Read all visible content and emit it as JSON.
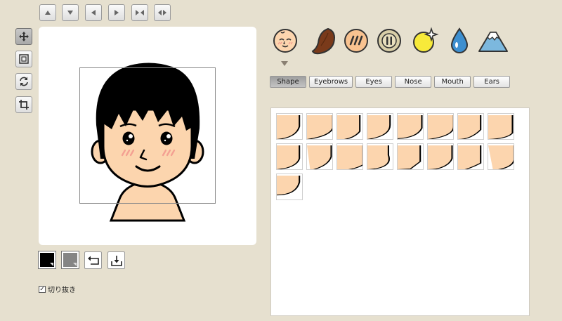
{
  "toolbar_top": {
    "buttons": [
      {
        "name": "move-up-button",
        "icon": "arrow-up-icon"
      },
      {
        "name": "move-down-button",
        "icon": "arrow-down-icon"
      },
      {
        "name": "move-left-button",
        "icon": "arrow-left-icon"
      },
      {
        "name": "move-right-button",
        "icon": "arrow-right-icon"
      },
      {
        "name": "narrow-button",
        "icon": "narrow-icon"
      },
      {
        "name": "widen-button",
        "icon": "widen-icon"
      }
    ]
  },
  "tools_left": [
    {
      "name": "move-tool",
      "icon": "move-icon",
      "active": true
    },
    {
      "name": "frame-tool",
      "icon": "frame-icon",
      "active": false
    },
    {
      "name": "rotate-tool",
      "icon": "rotate-icon",
      "active": false
    },
    {
      "name": "crop-tool",
      "icon": "crop-icon",
      "active": false
    }
  ],
  "colors": {
    "background": "#e6e0cf",
    "skin": "#fcd5ae",
    "hair": "#000000",
    "blush": "#f4a092",
    "swatch_primary": "#000000",
    "swatch_secondary": "#858585"
  },
  "crop_checkbox": {
    "label": "切り抜き",
    "checked": true
  },
  "categories": [
    {
      "name": "face",
      "icon": "face-icon"
    },
    {
      "name": "hair",
      "icon": "hair-icon"
    },
    {
      "name": "pattern",
      "icon": "stripes-icon"
    },
    {
      "name": "button",
      "icon": "button-icon"
    },
    {
      "name": "sparkle",
      "icon": "sparkle-moon-icon"
    },
    {
      "name": "drop",
      "icon": "drop-icon"
    },
    {
      "name": "mountain",
      "icon": "mountain-icon"
    }
  ],
  "tabs": [
    {
      "label": "Shape",
      "active": true
    },
    {
      "label": "Eyebrows",
      "active": false
    },
    {
      "label": "Eyes",
      "active": false
    },
    {
      "label": "Nose",
      "active": false
    },
    {
      "label": "Mouth",
      "active": false
    },
    {
      "label": "Ears",
      "active": false
    }
  ],
  "parts": {
    "count": 17
  }
}
